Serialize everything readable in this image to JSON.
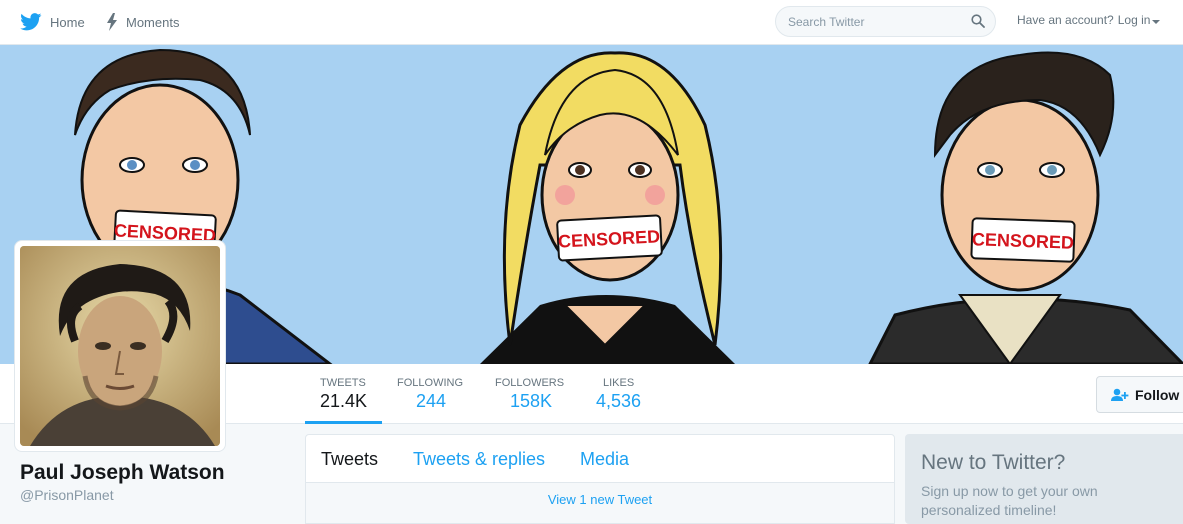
{
  "nav": {
    "home_label": "Home",
    "moments_label": "Moments",
    "search_placeholder": "Search Twitter",
    "account_prompt": "Have an account?",
    "login_label": "Log in"
  },
  "banner": {
    "censored_text": "CENSORED"
  },
  "profile": {
    "name": "Paul Joseph Watson",
    "handle": "@PrisonPlanet",
    "follow_label": "Follow"
  },
  "stats": [
    {
      "label": "TWEETS",
      "value": "21.4K"
    },
    {
      "label": "FOLLOWING",
      "value": "244"
    },
    {
      "label": "FOLLOWERS",
      "value": "158K"
    },
    {
      "label": "LIKES",
      "value": "4,536"
    }
  ],
  "timeline": {
    "tabs": [
      {
        "label": "Tweets"
      },
      {
        "label": "Tweets & replies"
      },
      {
        "label": "Media"
      }
    ],
    "new_tweet_label": "View 1 new Tweet"
  },
  "signup": {
    "title": "New to Twitter?",
    "subtitle": "Sign up now to get your own personalized timeline!"
  },
  "colors": {
    "accent": "#1da1f2",
    "banner_bg": "#a8d1f2"
  }
}
